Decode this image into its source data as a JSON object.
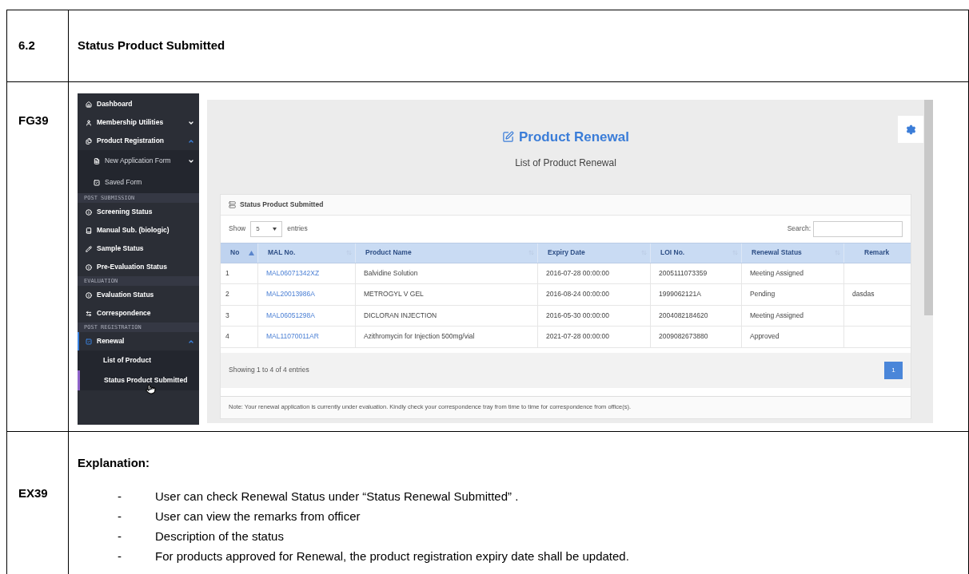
{
  "heading": {
    "number": "6.2",
    "title": "Status Product Submitted"
  },
  "figure": {
    "label": "FG39",
    "sidebar": [
      {
        "kind": "item",
        "label": "Dashboard",
        "selected": false
      },
      {
        "kind": "item",
        "label": "Membership Utilities",
        "selected": false,
        "expanded": false
      },
      {
        "kind": "item",
        "label": "Product Registration",
        "selected": false,
        "expanded": true,
        "children": [
          {
            "kind": "item",
            "label": "New Application Form",
            "selected": false,
            "expanded": false
          },
          {
            "kind": "item",
            "label": "Saved Form",
            "selected": false
          }
        ]
      },
      {
        "kind": "section",
        "label": "POST SUBMISSION"
      },
      {
        "kind": "item",
        "label": "Screening Status",
        "selected": false
      },
      {
        "kind": "item",
        "label": "Manual Sub. (biologic)",
        "selected": false
      },
      {
        "kind": "item",
        "label": "Sample Status",
        "selected": false
      },
      {
        "kind": "item",
        "label": "Pre-Evaluation Status",
        "selected": false
      },
      {
        "kind": "section",
        "label": "EVALUATION"
      },
      {
        "kind": "item",
        "label": "Evaluation Status",
        "selected": false
      },
      {
        "kind": "item",
        "label": "Correspondence",
        "selected": false
      },
      {
        "kind": "section",
        "label": "POST REGISTRATION"
      },
      {
        "kind": "item",
        "label": "Renewal",
        "selected": true,
        "expanded": true,
        "children": [
          {
            "kind": "item",
            "label": "List of Product",
            "selected": false
          },
          {
            "kind": "item",
            "label": "Status Product Submitted",
            "selected": true
          }
        ]
      }
    ],
    "page": {
      "title": "Product Renewal",
      "subtitle": "List of Product Renewal",
      "card_title": "Status Product Submitted",
      "show_label": "Show",
      "page_size": "5",
      "entries_label": "entries",
      "search_label": "Search:",
      "columns": [
        {
          "label": "No",
          "sortable": true,
          "sorted": true
        },
        {
          "label": "MAL No.",
          "sortable": true,
          "sorted": false
        },
        {
          "label": "Product Name",
          "sortable": true,
          "sorted": false
        },
        {
          "label": "Expiry Date",
          "sortable": true,
          "sorted": false
        },
        {
          "label": "LOI No.",
          "sortable": true,
          "sorted": false
        },
        {
          "label": "Renewal Status",
          "sortable": true,
          "sorted": false
        },
        {
          "label": "Remark",
          "sortable": false
        }
      ],
      "rows": [
        [
          "1",
          "MAL06071342XZ",
          "Balvidine Solution",
          "2016-07-28 00:00:00",
          "2005111073359",
          "Meeting Assigned",
          ""
        ],
        [
          "2",
          "MAL20013986A",
          "METROGYL V GEL",
          "2016-08-24 00:00:00",
          "1999062121A",
          "Pending",
          "dasdas"
        ],
        [
          "3",
          "MAL06051298A",
          "DICLORAN INJECTION",
          "2016-05-30 00:00:00",
          "2004082184620",
          "Meeting Assigned",
          ""
        ],
        [
          "4",
          "MAL11070011AR",
          "Azithromycin for Injection 500mg/vial",
          "2021-07-28 00:00:00",
          "2009082673880",
          "Approved",
          ""
        ]
      ],
      "info": "Showing 1 to 4 of 4 entries",
      "pages": [
        {
          "label": "1",
          "selected": true
        }
      ],
      "note": "Note: Your renewal application is currently under evaluation. Kindly check your correspondence tray from time to time for correspondence from office(s)."
    }
  },
  "explanation": {
    "label": "EX39",
    "title": "Explanation:",
    "items": [
      {
        "marker": "-",
        "text": "User can check Renewal Status under “Status Renewal Submitted” ."
      },
      {
        "marker": "-",
        "text": "User can view the remarks from officer"
      },
      {
        "marker": "-",
        "text": "Description of the status"
      },
      {
        "marker": "-",
        "text": "For products approved for Renewal, the product registration expiry date shall be updated."
      }
    ]
  }
}
